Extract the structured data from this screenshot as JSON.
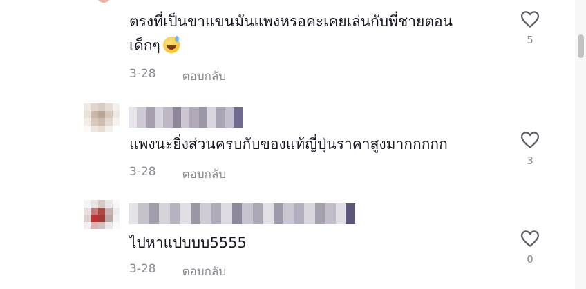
{
  "comments": [
    {
      "text_line1": "ตรงที่เป็นขาแขนมันแพงหรอคะเคยเล่นกับพี่ชายตอน",
      "text_line2": "เด็กๆ",
      "emoji": "sweat-smile-emoji",
      "date": "3-28",
      "reply_label": "ตอบกลับ",
      "likes": "5"
    },
    {
      "text": "แพงนะยิ่งส่วนครบกับของแท้ญี่ปุ่นราคาสูงมากกกกก",
      "date": "3-28",
      "reply_label": "ตอบกลับ",
      "likes": "3"
    },
    {
      "text": "ไปหาแปบบบ5555",
      "date": "3-28",
      "reply_label": "ตอบกลับ",
      "likes": "0"
    }
  ],
  "icons": {
    "like": "heart-outline-icon"
  },
  "colors": {
    "text": "#161823",
    "muted": "#8a8b91",
    "heart_stroke": "#5c5d63"
  }
}
